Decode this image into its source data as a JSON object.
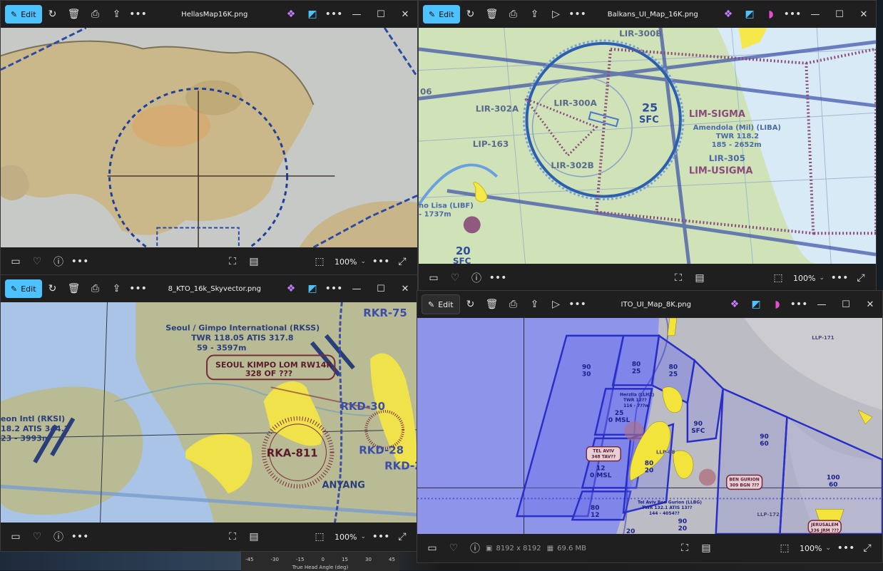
{
  "windows": [
    {
      "id": "w1",
      "title": "HellasMap16K.png",
      "edit_label": "Edit",
      "zoom": "100%"
    },
    {
      "id": "w2",
      "title": "Balkans_UI_Map_16K.png",
      "edit_label": "Edit",
      "zoom": "100%"
    },
    {
      "id": "w3",
      "title": "8_KTO_16k_Skyvector.png",
      "edit_label": "Edit",
      "zoom": "100%"
    },
    {
      "id": "w4",
      "title": "ITO_UI_Map_8K.png",
      "edit_label": "Edit",
      "zoom": "100%",
      "dimensions": "8192 x 8192",
      "file_size": "69.6 MB"
    }
  ],
  "background": {
    "ticks": [
      "-45",
      "-30",
      "-15",
      "0",
      "15",
      "30",
      "45"
    ],
    "caption": "True Head Angle (deg)"
  },
  "maps": {
    "balkans": {
      "labels": {
        "lir300b": "LIR-300B",
        "lir300a": "LIR-300A",
        "lir302a": "LIR-302A",
        "lir302b": "LIR-302B",
        "lip163": "LIP-163",
        "n06": "06",
        "alt25": "25",
        "sfc25": "SFC",
        "limsigma": "LIM-SIGMA",
        "amendola": "Amendola (Mil) (LIBA)",
        "twr": "TWR 118.2",
        "elev": "185 - 2652m",
        "lir305": "LIR-305",
        "limusigma": "LIM-USIGMA",
        "lisa": "no Lisa (LIBF)",
        "lisa2": "- 1737m",
        "alt20": "20",
        "sfc20": "SFC"
      }
    },
    "kto": {
      "labels": {
        "gimpo": "Seoul / Gimpo International (RKSS)",
        "gimpo_twr": "TWR 118.05 ATIS 317.8",
        "gimpo_elev": "59 - 3597m",
        "lom1": "SEOUL KIMPO LOM RW14R",
        "lom2": "328 OF ???",
        "incheon1": "eon Intl (RKSI)",
        "incheon2": "18.2 ATIS 344.2",
        "incheon3": "23 - 3993m",
        "rka": "RKA-811",
        "rkd30": "RKD-30",
        "rkd28": "RKD-28",
        "rkd2": "RKD-2",
        "rkr": "RKR-75",
        "anyang": "ANYANG"
      }
    },
    "ito": {
      "labels": {
        "a1": "90",
        "a1b": "30",
        "a2": "80",
        "a2b": "25",
        "a3": "80",
        "a3b": "25",
        "herzlia": "Herzlia (LLHZ)",
        "herzlia2": "TWR 12??",
        "herzlia3": "116 - 7??m",
        "b25": "25",
        "b25b": "0 MSL",
        "c90": "90",
        "c90b": "SFC",
        "telaviv": "TEL AVIV",
        "telaviv2": "348 TAV??",
        "llp08": "LLP-08",
        "d12": "12",
        "d12b": "0 MSL",
        "e80": "80",
        "e80b": "20",
        "f90": "90",
        "f90b": "60",
        "g100": "100",
        "g100b": "60",
        "bengurion": "BEN GURION",
        "bengurion2": "309 BGN ???",
        "llbg": "Tel Aviv Ben Gurion (LLBG)",
        "llbg2": "TWR 132.1 ATIS 13??",
        "llbg3": "144 - 4054??",
        "h80": "80",
        "h80b": "12",
        "i90": "90",
        "i90b": "20",
        "j20": "20",
        "llp172": "LLP-172",
        "llp171": "LLP-171",
        "jerusalem": "JERUSALEM",
        "jerusalem2": "336 JRM ???"
      }
    }
  }
}
